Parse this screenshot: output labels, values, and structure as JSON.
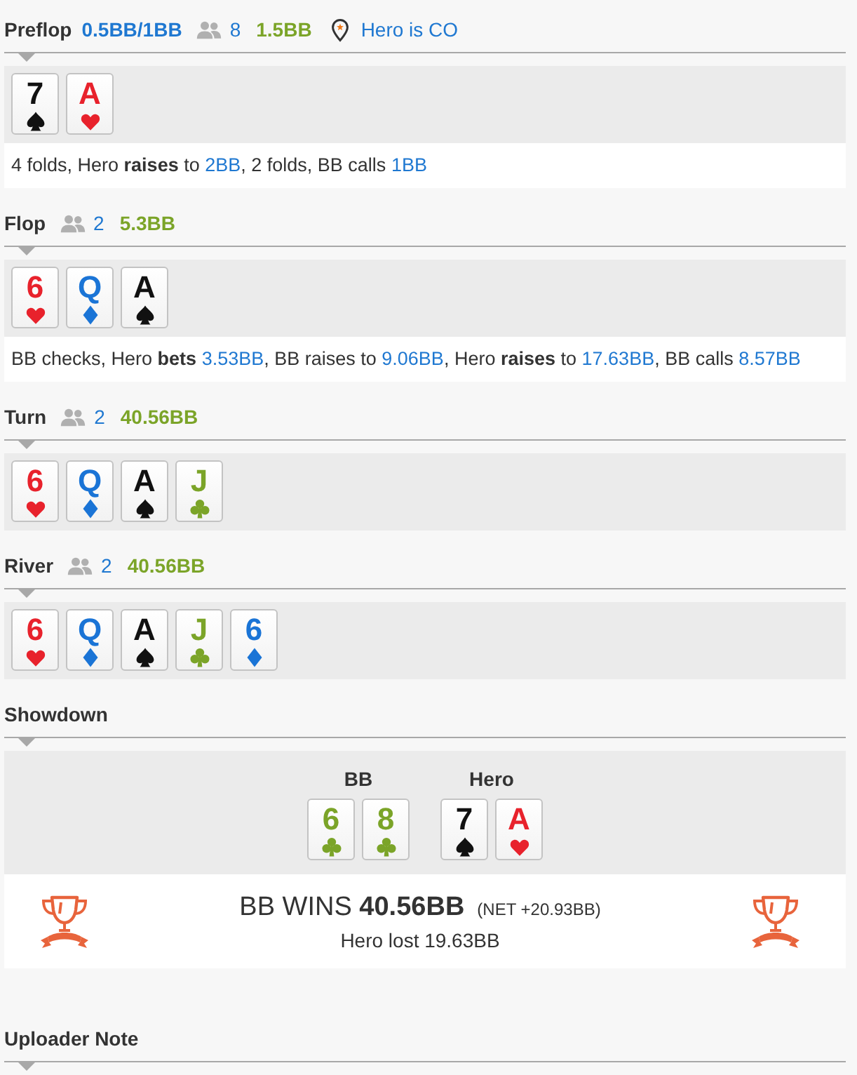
{
  "streets": [
    {
      "title": "Preflop",
      "blinds": "0.5BB/1BB",
      "players": "8",
      "pot": "1.5BB",
      "position": "Hero is CO",
      "cards": [
        {
          "rank": "7",
          "kind": "spades"
        },
        {
          "rank": "A",
          "kind": "hearts"
        }
      ],
      "action": [
        {
          "kind": "text",
          "text": "4 folds, Hero "
        },
        {
          "kind": "bold",
          "text": "raises"
        },
        {
          "kind": "text",
          "text": " to "
        },
        {
          "kind": "amount",
          "text": "2BB"
        },
        {
          "kind": "text",
          "text": ", 2 folds, BB calls "
        },
        {
          "kind": "amount",
          "text": "1BB"
        }
      ]
    },
    {
      "title": "Flop",
      "players": "2",
      "pot": "5.3BB",
      "cards": [
        {
          "rank": "6",
          "kind": "hearts"
        },
        {
          "rank": "Q",
          "kind": "diamonds"
        },
        {
          "rank": "A",
          "kind": "spades"
        }
      ],
      "action": [
        {
          "kind": "text",
          "text": "BB checks, Hero "
        },
        {
          "kind": "bold",
          "text": "bets "
        },
        {
          "kind": "amount",
          "text": "3.53BB"
        },
        {
          "kind": "text",
          "text": ", BB raises to "
        },
        {
          "kind": "amount",
          "text": "9.06BB"
        },
        {
          "kind": "text",
          "text": ", Hero "
        },
        {
          "kind": "bold",
          "text": "raises"
        },
        {
          "kind": "text",
          "text": " to "
        },
        {
          "kind": "amount",
          "text": "17.63BB"
        },
        {
          "kind": "text",
          "text": ", BB calls "
        },
        {
          "kind": "amount",
          "text": "8.57BB"
        }
      ]
    },
    {
      "title": "Turn",
      "players": "2",
      "pot": "40.56BB",
      "cards": [
        {
          "rank": "6",
          "kind": "hearts"
        },
        {
          "rank": "Q",
          "kind": "diamonds"
        },
        {
          "rank": "A",
          "kind": "spades"
        },
        {
          "rank": "J",
          "kind": "clubs"
        }
      ]
    },
    {
      "title": "River",
      "players": "2",
      "pot": "40.56BB",
      "cards": [
        {
          "rank": "6",
          "kind": "hearts"
        },
        {
          "rank": "Q",
          "kind": "diamonds"
        },
        {
          "rank": "A",
          "kind": "spades"
        },
        {
          "rank": "J",
          "kind": "clubs"
        },
        {
          "rank": "6",
          "kind": "diamonds"
        }
      ]
    }
  ],
  "showdown": {
    "title": "Showdown",
    "hands": [
      {
        "player": "BB",
        "cards": [
          {
            "rank": "6",
            "kind": "clubs"
          },
          {
            "rank": "8",
            "kind": "clubs"
          }
        ]
      },
      {
        "player": "Hero",
        "cards": [
          {
            "rank": "7",
            "kind": "spades"
          },
          {
            "rank": "A",
            "kind": "hearts"
          }
        ]
      }
    ],
    "result": {
      "headline": "BB WINS **40.56BB**",
      "net": "(NET +20.93BB)",
      "summary": "Hero lost 19.63BB"
    }
  },
  "uploader_note": {
    "title": "Uploader Note"
  }
}
